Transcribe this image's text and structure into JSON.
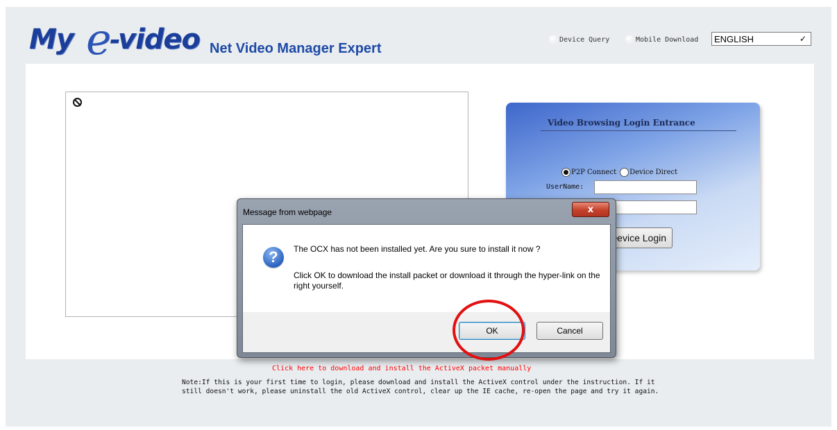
{
  "header": {
    "logo_my": "My",
    "logo_e": "e",
    "logo_dash": "-",
    "logo_video": "video",
    "logo_tagline": "Net Video Manager Expert",
    "device_query": "Device Query",
    "mobile_download": "Mobile Download",
    "language": "ENGLISH"
  },
  "login": {
    "title": "Video Browsing Login Entrance",
    "p2p_label": "P2P Connect",
    "direct_label": "Device Direct",
    "selected_mode": "P2P Connect",
    "username_label": "UserName:",
    "username_value": "",
    "password_value": "",
    "login_button": "Device Login"
  },
  "footer": {
    "activex_link": "Click here to download and install the ActiveX packet manually",
    "note": "Note:If this is your first time to login, please download and install the ActiveX control under the instruction. If it still doesn't work, please uninstall the old ActiveX control, clear up the IE cache, re-open the page and try it again."
  },
  "dialog": {
    "title": "Message from webpage",
    "close_glyph": "x",
    "icon": "question-icon",
    "message_line1": "The OCX has not been installed yet. Are you sure to install it now ?",
    "message_line2": "Click OK to download the install packet or download it through the hyper-link on the right yourself.",
    "ok_label": "OK",
    "cancel_label": "Cancel"
  },
  "colors": {
    "brand_blue": "#1b3e9a",
    "link_red": "#ff0000",
    "highlight_red": "#e21010"
  }
}
